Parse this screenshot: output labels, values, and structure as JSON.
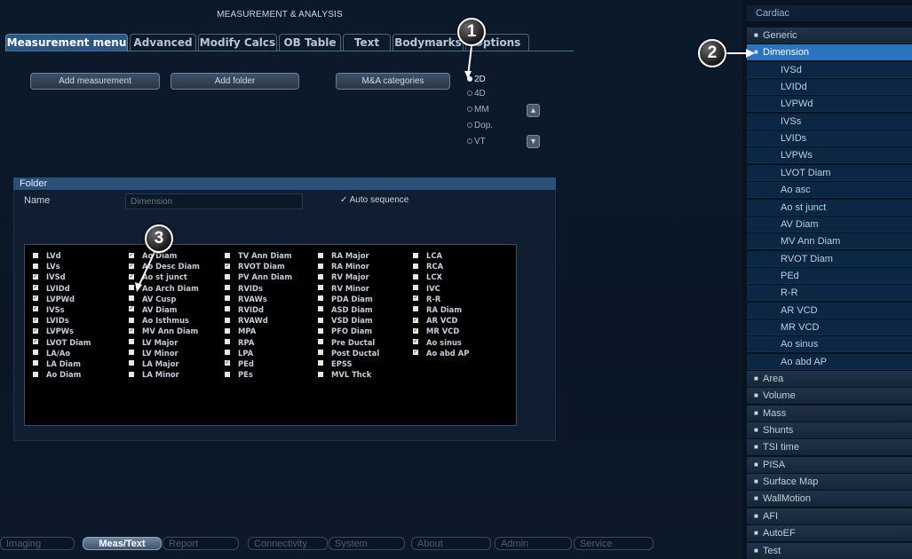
{
  "header": {
    "title": "MEASUREMENT & ANALYSIS"
  },
  "tabs": [
    "Measurement menu",
    "Advanced",
    "Modify Calcs",
    "OB Table",
    "Text",
    "Bodymarks",
    "Options"
  ],
  "buttons": {
    "add_measurement": "Add measurement",
    "add_folder": "Add folder",
    "ma_categories": "M&A categories"
  },
  "modes": [
    "2D",
    "4D",
    "MM",
    "Dop.",
    "VT"
  ],
  "mode_selected": "2D",
  "folder": {
    "header": "Folder",
    "name_label": "Name",
    "name_placeholder": "Dimension",
    "auto_sequence_label": "Auto sequence",
    "auto_sequence_checked": true
  },
  "checklist": [
    [
      {
        "label": "LVd",
        "checked": false
      },
      {
        "label": "LVs",
        "checked": false
      },
      {
        "label": "IVSd",
        "checked": true
      },
      {
        "label": "LVIDd",
        "checked": true
      },
      {
        "label": "LVPWd",
        "checked": true
      },
      {
        "label": "IVSs",
        "checked": true
      },
      {
        "label": "LVIDs",
        "checked": true
      },
      {
        "label": "LVPWs",
        "checked": true
      },
      {
        "label": "LVOT Diam",
        "checked": true
      },
      {
        "label": "LA/Ao",
        "checked": false
      },
      {
        "label": "LA Diam",
        "checked": false
      },
      {
        "label": "Ao Diam",
        "checked": false
      }
    ],
    [
      {
        "label": "Ao Diam",
        "checked": true
      },
      {
        "label": "Ao Desc Diam",
        "checked": true
      },
      {
        "label": "Ao st junct",
        "checked": true
      },
      {
        "label": "Ao Arch Diam",
        "checked": false
      },
      {
        "label": "AV Cusp",
        "checked": false
      },
      {
        "label": "AV Diam",
        "checked": true
      },
      {
        "label": "Ao Isthmus",
        "checked": false
      },
      {
        "label": "MV Ann Diam",
        "checked": true
      },
      {
        "label": "LV Major",
        "checked": false
      },
      {
        "label": "LV Minor",
        "checked": false
      },
      {
        "label": "LA Major",
        "checked": false
      },
      {
        "label": "LA Minor",
        "checked": false
      }
    ],
    [
      {
        "label": "TV Ann Diam",
        "checked": false
      },
      {
        "label": "RVOT Diam",
        "checked": true
      },
      {
        "label": "PV Ann Diam",
        "checked": false
      },
      {
        "label": "RVIDs",
        "checked": false
      },
      {
        "label": "RVAWs",
        "checked": false
      },
      {
        "label": "RVIDd",
        "checked": false
      },
      {
        "label": "RVAWd",
        "checked": false
      },
      {
        "label": "MPA",
        "checked": false
      },
      {
        "label": "RPA",
        "checked": false
      },
      {
        "label": "LPA",
        "checked": false
      },
      {
        "label": "PEd",
        "checked": true
      },
      {
        "label": "PEs",
        "checked": false
      }
    ],
    [
      {
        "label": "RA Major",
        "checked": false
      },
      {
        "label": "RA Minor",
        "checked": false
      },
      {
        "label": "RV Major",
        "checked": false
      },
      {
        "label": "RV Minor",
        "checked": false
      },
      {
        "label": "PDA Diam",
        "checked": false
      },
      {
        "label": "ASD Diam",
        "checked": false
      },
      {
        "label": "VSD Diam",
        "checked": false
      },
      {
        "label": "PFO Diam",
        "checked": false
      },
      {
        "label": "Pre Ductal",
        "checked": false
      },
      {
        "label": "Post Ductal",
        "checked": false
      },
      {
        "label": "EPSS",
        "checked": false
      },
      {
        "label": "MVL Thck",
        "checked": false
      }
    ],
    [
      {
        "label": "LCA",
        "checked": false
      },
      {
        "label": "RCA",
        "checked": false
      },
      {
        "label": "LCX",
        "checked": false
      },
      {
        "label": "IVC",
        "checked": false
      },
      {
        "label": "R-R",
        "checked": true
      },
      {
        "label": "RA Diam",
        "checked": false
      },
      {
        "label": "AR VCD",
        "checked": true
      },
      {
        "label": "MR VCD",
        "checked": true
      },
      {
        "label": "Ao sinus",
        "checked": true
      },
      {
        "label": "Ao abd AP",
        "checked": true
      }
    ]
  ],
  "bottom_tabs": [
    "Imaging",
    "Meas/Text",
    "Report",
    "Connectivity",
    "System",
    "About",
    "Admin",
    "Service"
  ],
  "bottom_tab_active": "Meas/Text",
  "sidebar": {
    "header": "Cardiac",
    "items": [
      {
        "label": "Generic",
        "type": "cat"
      },
      {
        "label": "Dimension",
        "type": "sel"
      },
      {
        "label": "IVSd",
        "type": "sub"
      },
      {
        "label": "LVIDd",
        "type": "sub"
      },
      {
        "label": "LVPWd",
        "type": "sub"
      },
      {
        "label": "IVSs",
        "type": "sub"
      },
      {
        "label": "LVIDs",
        "type": "sub"
      },
      {
        "label": "LVPWs",
        "type": "sub"
      },
      {
        "label": "LVOT Diam",
        "type": "sub"
      },
      {
        "label": "Ao asc",
        "type": "sub"
      },
      {
        "label": "Ao st junct",
        "type": "sub"
      },
      {
        "label": "AV Diam",
        "type": "sub"
      },
      {
        "label": "MV Ann Diam",
        "type": "sub"
      },
      {
        "label": "RVOT Diam",
        "type": "sub"
      },
      {
        "label": "PEd",
        "type": "sub"
      },
      {
        "label": "R-R",
        "type": "sub"
      },
      {
        "label": "AR VCD",
        "type": "sub"
      },
      {
        "label": "MR VCD",
        "type": "sub"
      },
      {
        "label": "Ao sinus",
        "type": "sub"
      },
      {
        "label": "Ao abd AP",
        "type": "sub"
      },
      {
        "label": "Area",
        "type": "cat"
      },
      {
        "label": "Volume",
        "type": "cat"
      },
      {
        "label": "Mass",
        "type": "cat"
      },
      {
        "label": "Shunts",
        "type": "cat"
      },
      {
        "label": "TSI time",
        "type": "cat"
      },
      {
        "label": "PISA",
        "type": "cat"
      },
      {
        "label": "Surface Map",
        "type": "cat"
      },
      {
        "label": "WallMotion",
        "type": "cat"
      },
      {
        "label": "AFI",
        "type": "cat"
      },
      {
        "label": "AutoEF",
        "type": "cat"
      },
      {
        "label": "Test",
        "type": "cat"
      }
    ]
  },
  "callouts": [
    "1",
    "2",
    "3"
  ],
  "icons": {
    "arrow_up": "arrow-up-icon",
    "arrow_down": "arrow-down-icon",
    "folder": "folder-icon",
    "checkbox": "checkbox-icon"
  },
  "colors": {
    "accent": "#2a73bf",
    "tab_active": "#2c5785",
    "folder_header": "#2a4f79"
  }
}
